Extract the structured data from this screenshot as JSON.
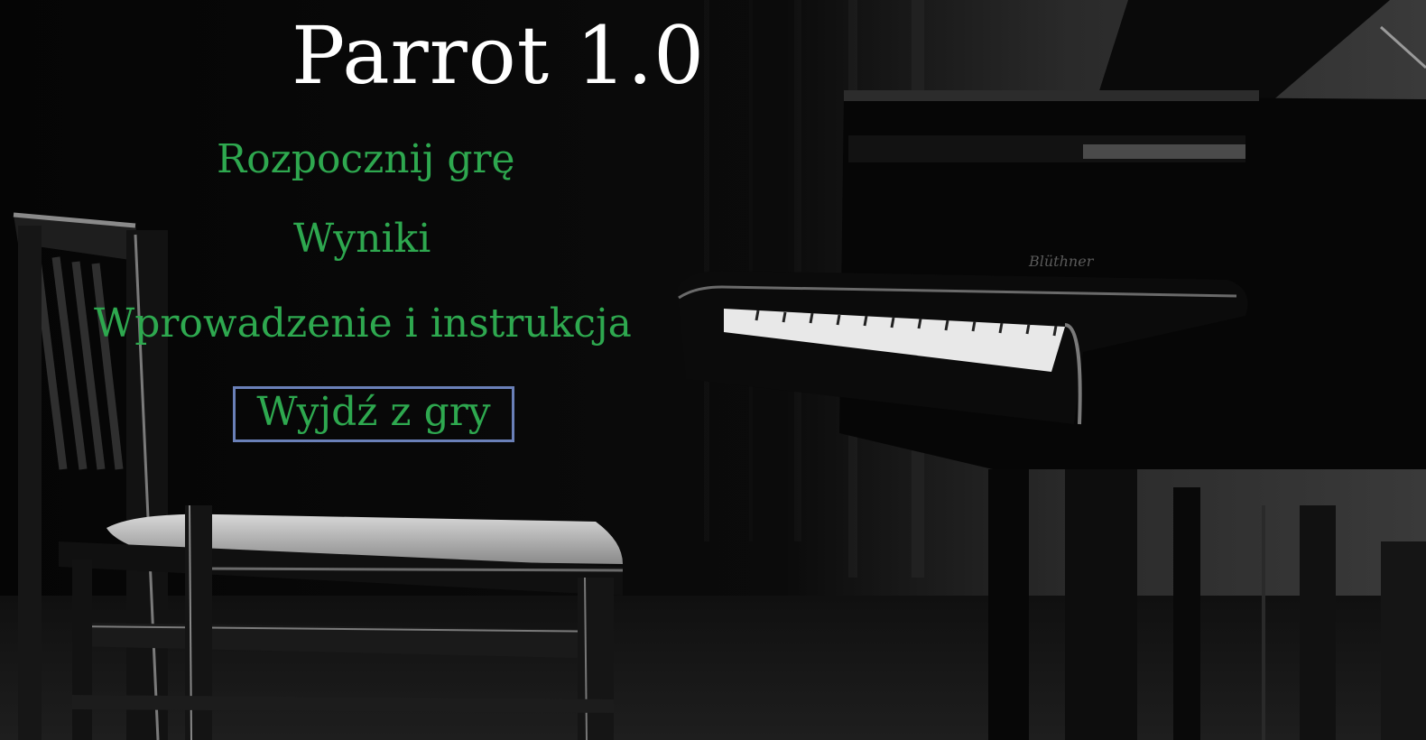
{
  "title": "Parrot 1.0",
  "menu": {
    "start": "Rozpocznij grę",
    "scores": "Wyniki",
    "intro": "Wprowadzenie i instrukcja",
    "exit": "Wyjdź z gry",
    "selected": "exit"
  },
  "background": {
    "description_icon": "piano-and-chair-photo",
    "piano_brand": "Blüthner"
  },
  "colors": {
    "background": "#050505",
    "title": "#ffffff",
    "menu_text": "#2ea84f",
    "selection_border": "#6a80b8"
  }
}
